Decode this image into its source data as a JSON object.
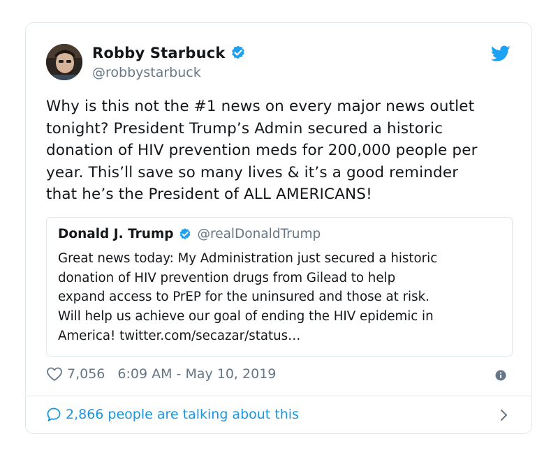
{
  "tweet": {
    "author_name": "Robby Starbuck",
    "author_handle": "@robbystarbuck",
    "text": "Why is this not the #1 news on every major news outlet\ntonight? President Trump’s Admin secured a historic\ndonation of HIV prevention meds for 200,000 people per\nyear. This’ll save so many lives & it’s a good reminder\nthat he’s the President of ALL AMERICANS!",
    "likes": "7,056",
    "timestamp": "6:09 AM - May 10, 2019",
    "talking": "2,866 people are talking about this"
  },
  "quoted": {
    "author_name": "Donald J. Trump",
    "author_handle": "@realDonaldTrump",
    "text": "Great news today: My Administration just secured a historic\ndonation of HIV prevention drugs from Gilead to help\nexpand access to PrEP for the uninsured and those at risk.\nWill help us achieve our goal of ending the HIV epidemic in\nAmerica! twitter.com/secazar/status…"
  },
  "icons": [
    "verified-icon",
    "twitter-bird-icon",
    "heart-icon",
    "info-icon",
    "reply-bubble-icon",
    "chevron-right-icon"
  ],
  "colors": {
    "accent": "#1da1f2",
    "link": "#1b95e0",
    "muted": "#657786",
    "border": "#e1e8ed"
  }
}
